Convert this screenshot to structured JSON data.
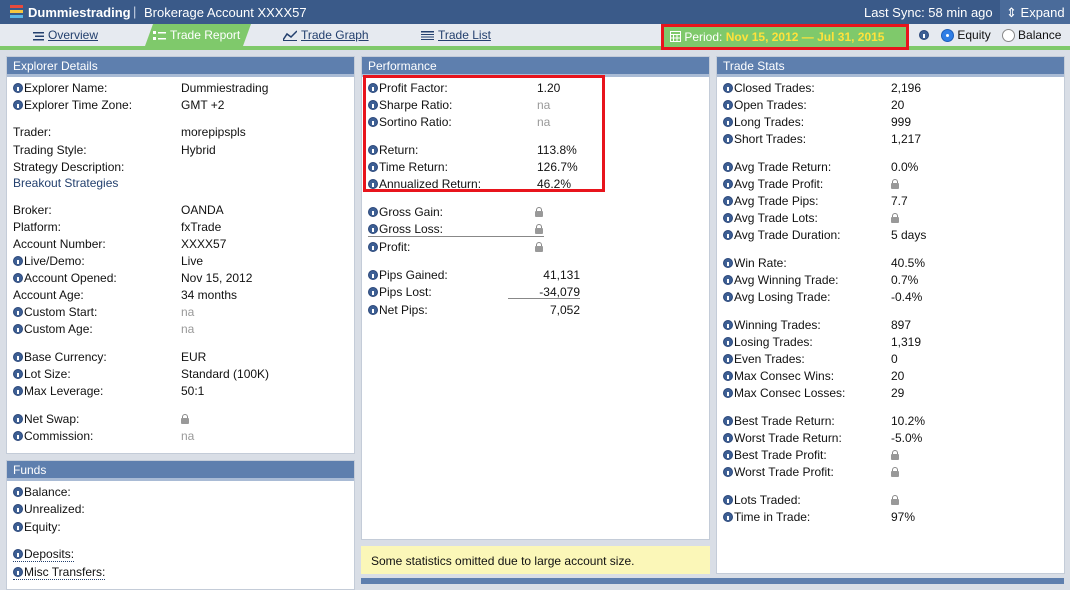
{
  "topbar": {
    "brand": "Dummiestrading",
    "account": "Brokerage Account XXXX57",
    "sync": "Last Sync: 58 min ago",
    "expand": "Expand"
  },
  "tabs": {
    "overview": "Overview",
    "trade_report": "Trade Report",
    "trade_graph": "Trade Graph",
    "trade_list": "Trade List"
  },
  "period": {
    "label": "Period:",
    "dates": "Nov 15, 2012 — Jul 31, 2015"
  },
  "mode": {
    "equity": "Equity",
    "balance": "Balance",
    "selected": "Equity"
  },
  "explorer": {
    "title": "Explorer Details",
    "rows": [
      {
        "label": "Explorer Name:",
        "value": "Dummiestrading",
        "info": true
      },
      {
        "label": "Explorer Time Zone:",
        "value": "GMT +2",
        "info": true
      },
      {
        "label": "Trader:",
        "value": "morepipspls",
        "link": true
      },
      {
        "label": "Trading Style:",
        "value": "Hybrid"
      },
      {
        "label": "Strategy Description:",
        "value": ""
      },
      {
        "label": "Breakout Strategies",
        "value": "",
        "blue": true
      },
      {
        "label": "Broker:",
        "value": "OANDA",
        "link": true
      },
      {
        "label": "Platform:",
        "value": "fxTrade"
      },
      {
        "label": "Account Number:",
        "value": "XXXX57"
      },
      {
        "label": "Live/Demo:",
        "value": "Live",
        "info": true
      },
      {
        "label": "Account Opened:",
        "value": "Nov 15, 2012",
        "info": true
      },
      {
        "label": "Account Age:",
        "value": "34 months"
      },
      {
        "label": "Custom Start:",
        "value": "na",
        "info": true,
        "na": true
      },
      {
        "label": "Custom Age:",
        "value": "na",
        "info": true,
        "na": true
      },
      {
        "label": "Base Currency:",
        "value": "EUR",
        "info": true
      },
      {
        "label": "Lot Size:",
        "value": "Standard (100K)",
        "info": true
      },
      {
        "label": "Max Leverage:",
        "value": "50:1",
        "info": true
      },
      {
        "label": "Net Swap:",
        "value": "",
        "info": true,
        "lock": true
      },
      {
        "label": "Commission:",
        "value": "na",
        "info": true,
        "na": true
      }
    ]
  },
  "funds": {
    "title": "Funds",
    "rows": [
      {
        "label": "Balance:",
        "info": true
      },
      {
        "label": "Unrealized:",
        "info": true
      },
      {
        "label": "Equity:",
        "info": true
      },
      {
        "label": "Deposits:",
        "info": true,
        "link": true
      },
      {
        "label": "Misc Transfers:",
        "info": true,
        "link": true
      }
    ]
  },
  "performance": {
    "title": "Performance",
    "rows": [
      {
        "label": "Profit Factor:",
        "value": "1.20"
      },
      {
        "label": "Sharpe Ratio:",
        "value": "na",
        "na": true
      },
      {
        "label": "Sortino Ratio:",
        "value": "na",
        "na": true
      },
      {
        "label": "Return:",
        "value": "113.8%"
      },
      {
        "label": "Time Return:",
        "value": "126.7%"
      },
      {
        "label": "Annualized Return:",
        "value": "46.2%"
      },
      {
        "label": "Gross Gain:",
        "value": "",
        "lock": true
      },
      {
        "label": "Gross Loss:",
        "value": "",
        "lock": true
      },
      {
        "label": "Profit:",
        "value": "",
        "lock": true
      },
      {
        "label": "Pips Gained:",
        "value": "41,131"
      },
      {
        "label": "Pips Lost:",
        "value": "-34,079"
      },
      {
        "label": "Net Pips:",
        "value": "7,052"
      }
    ],
    "note": "Some statistics omitted due to large account size."
  },
  "stats": {
    "title": "Trade Stats",
    "rows": [
      {
        "label": "Closed Trades:",
        "value": "2,196"
      },
      {
        "label": "Open Trades:",
        "value": "20"
      },
      {
        "label": "Long Trades:",
        "value": "999"
      },
      {
        "label": "Short Trades:",
        "value": "1,217"
      },
      {
        "label": "Avg Trade Return:",
        "value": "0.0%"
      },
      {
        "label": "Avg Trade Profit:",
        "value": "",
        "lock": true
      },
      {
        "label": "Avg Trade Pips:",
        "value": "7.7"
      },
      {
        "label": "Avg Trade Lots:",
        "value": "",
        "lock": true
      },
      {
        "label": "Avg Trade Duration:",
        "value": "5 days"
      },
      {
        "label": "Win Rate:",
        "value": "40.5%"
      },
      {
        "label": "Avg Winning Trade:",
        "value": "0.7%"
      },
      {
        "label": "Avg Losing Trade:",
        "value": "-0.4%"
      },
      {
        "label": "Winning Trades:",
        "value": "897"
      },
      {
        "label": "Losing Trades:",
        "value": "1,319"
      },
      {
        "label": "Even Trades:",
        "value": "0"
      },
      {
        "label": "Max Consec Wins:",
        "value": "20"
      },
      {
        "label": "Max Consec Losses:",
        "value": "29"
      },
      {
        "label": "Best Trade Return:",
        "value": "10.2%"
      },
      {
        "label": "Worst Trade Return:",
        "value": "-5.0%"
      },
      {
        "label": "Best Trade Profit:",
        "value": "",
        "lock": true
      },
      {
        "label": "Worst Trade Profit:",
        "value": "",
        "lock": true
      },
      {
        "label": "Lots Traded:",
        "value": "",
        "lock": true
      },
      {
        "label": "Time in Trade:",
        "value": "97%"
      }
    ]
  },
  "colors": {
    "header": "#3a5a89",
    "accent_green": "#7fc96b",
    "highlight_red": "#e8141c",
    "period_dates": "#ffe23b"
  }
}
